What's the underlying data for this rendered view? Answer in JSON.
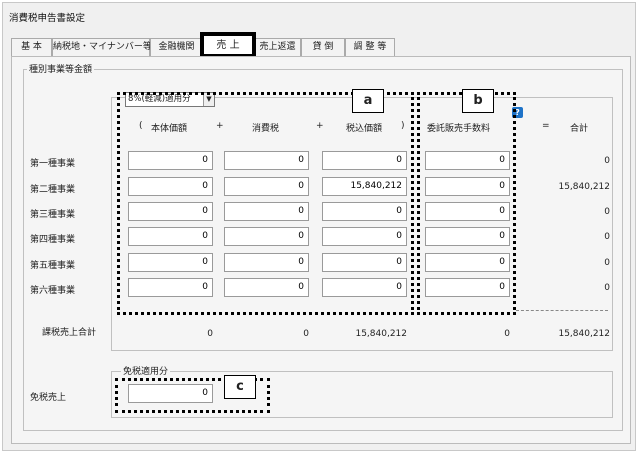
{
  "window": {
    "title": "消費税申告書設定"
  },
  "tabs": [
    {
      "label": "基 本"
    },
    {
      "label": "納税地・マイナンバー等"
    },
    {
      "label": "金融機関"
    },
    {
      "label": "売 上"
    },
    {
      "label": "売上返還"
    },
    {
      "label": "貸 倒"
    },
    {
      "label": "調 整 等"
    }
  ],
  "section": {
    "title": "種別事業等金額",
    "rate_select": "8%(軽減)適用分",
    "headers": {
      "open_paren": "(",
      "base": "本体価額",
      "plus1": "+",
      "tax": "消費税",
      "plus2": "+",
      "incl": "税込価額",
      "close_paren": ")",
      "commission": "委託販売手数料",
      "equals": "=",
      "total": "合計"
    },
    "rows": [
      {
        "label": "第一種事業",
        "base": "0",
        "tax": "0",
        "incl": "0",
        "commission": "0",
        "total": "0"
      },
      {
        "label": "第二種事業",
        "base": "0",
        "tax": "0",
        "incl": "15,840,212",
        "commission": "0",
        "total": "15,840,212"
      },
      {
        "label": "第三種事業",
        "base": "0",
        "tax": "0",
        "incl": "0",
        "commission": "0",
        "total": "0"
      },
      {
        "label": "第四種事業",
        "base": "0",
        "tax": "0",
        "incl": "0",
        "commission": "0",
        "total": "0"
      },
      {
        "label": "第五種事業",
        "base": "0",
        "tax": "0",
        "incl": "0",
        "commission": "0",
        "total": "0"
      },
      {
        "label": "第六種事業",
        "base": "0",
        "tax": "0",
        "incl": "0",
        "commission": "0",
        "total": "0"
      }
    ],
    "summary": {
      "label": "課税売上合計",
      "base": "0",
      "tax": "0",
      "incl": "15,840,212",
      "commission": "0",
      "total": "15,840,212"
    }
  },
  "exempt": {
    "title": "免税適用分",
    "label": "免税売上",
    "value": "0"
  },
  "help_icon": "?",
  "callouts": {
    "a": "a",
    "b": "b",
    "c": "c"
  }
}
